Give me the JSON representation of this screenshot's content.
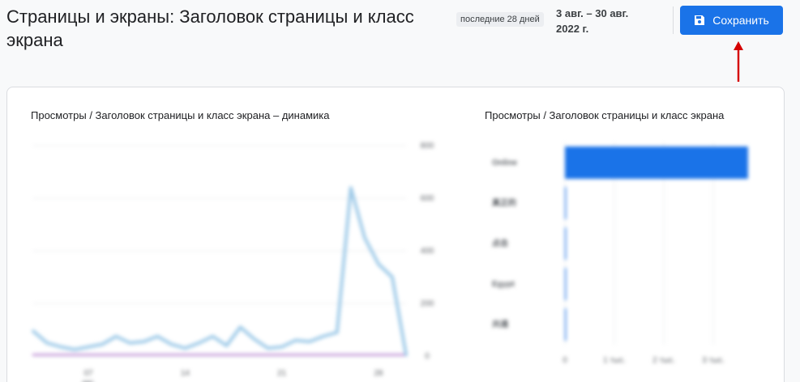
{
  "header": {
    "title": "Страницы и экраны: Заголовок страницы и класс экрана",
    "range_label": "последние 28 дней",
    "date_range": "3 авг. – 30 авг. 2022 г.",
    "save_label": "Сохранить"
  },
  "colors": {
    "accent": "#1a73e8",
    "line_series": "#9ecae8",
    "baseline_series": "#c9a0dc",
    "annotation_arrow": "#d50000"
  },
  "icons": {
    "save": "floppy-disk-icon",
    "annotation": "red-arrow-up-icon"
  },
  "chart_data": [
    {
      "type": "line",
      "title": "Просмотры / Заголовок страницы и класс экрана – динамика",
      "x_ticks": [
        "07",
        "14",
        "21",
        "28"
      ],
      "x_sub_label": "авг.",
      "y_ticks": [
        0,
        200,
        400,
        600,
        800
      ],
      "ylim": [
        0,
        800
      ],
      "grid": true,
      "series": [
        {
          "values": [
            95,
            50,
            35,
            25,
            35,
            45,
            75,
            50,
            55,
            75,
            45,
            30,
            50,
            75,
            40,
            110,
            65,
            30,
            35,
            60,
            55,
            75,
            90,
            640,
            450,
            350,
            300,
            5
          ]
        },
        {
          "values": [
            5,
            5,
            5,
            5,
            5,
            5,
            5,
            5,
            5,
            5,
            5,
            5,
            5,
            5,
            5,
            5,
            5,
            5,
            5,
            5,
            5,
            5,
            5,
            5,
            5,
            5,
            5,
            5
          ]
        }
      ]
    },
    {
      "type": "bar",
      "orientation": "horizontal",
      "title": "Просмотры / Заголовок страницы и класс экрана",
      "categories": [
        "Online",
        "真正的",
        "点击",
        "Egypt",
        "共通"
      ],
      "values": [
        3.7,
        0.0,
        0.0,
        0.0,
        0.0
      ],
      "x_ticks": [
        "0",
        "1 тыс.",
        "2 тыс.",
        "3 тыс."
      ],
      "xlim": [
        0,
        3.8
      ],
      "grid": true
    }
  ]
}
